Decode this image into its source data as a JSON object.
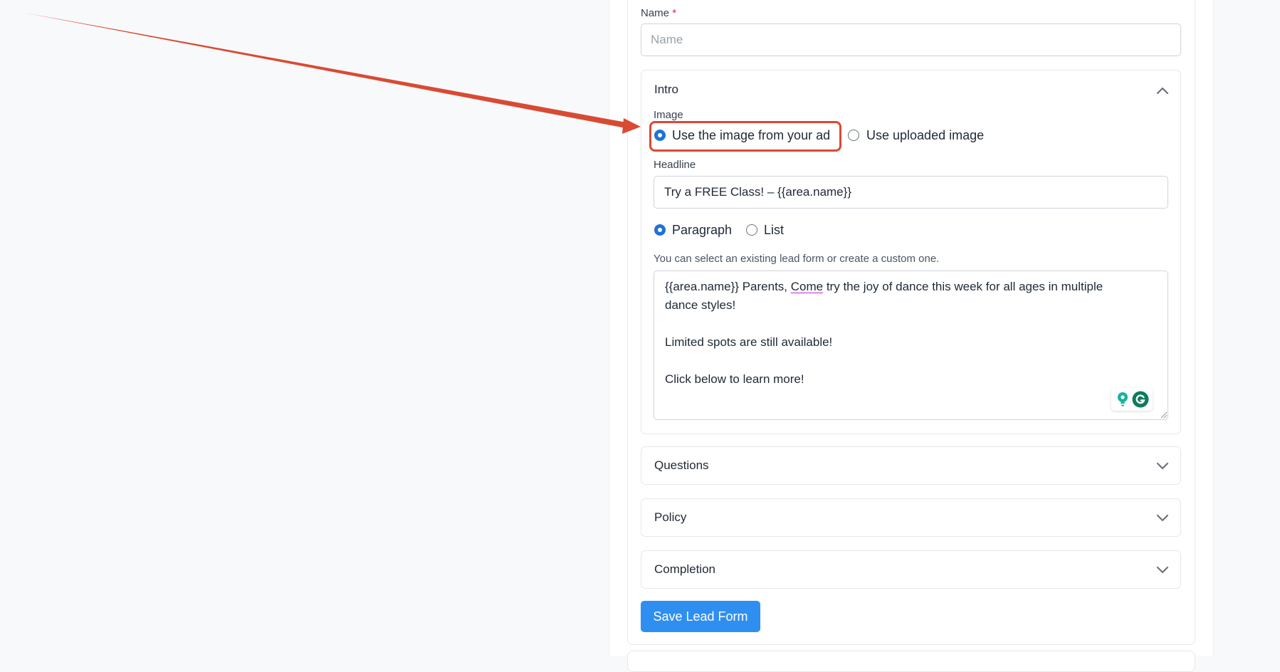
{
  "colors": {
    "accent": "#2f8ff0",
    "radio_checked": "#1e72d9",
    "annotation": "#d94a33",
    "required": "#e11d48"
  },
  "name_field": {
    "label": "Name",
    "required_mark": "*",
    "placeholder": "Name",
    "value": ""
  },
  "intro": {
    "title": "Intro",
    "expanded": true,
    "image_label": "Image",
    "image_options": [
      {
        "label": "Use the image from your ad",
        "selected": true
      },
      {
        "label": "Use uploaded image",
        "selected": false
      }
    ],
    "headline_label": "Headline",
    "headline_value": "Try a FREE Class! – {{area.name}}",
    "format_options": [
      {
        "label": "Paragraph",
        "selected": true
      },
      {
        "label": "List",
        "selected": false
      }
    ],
    "hint": "You can select an existing lead form or create a custom one.",
    "body_lines": {
      "line1_pre": "{{area.name}} Parents, ",
      "line1_come": "Come",
      "line1_post": " try the joy of dance this week for all ages in multiple",
      "line2": "dance styles!",
      "line3": "Limited spots are still available!",
      "line4": "Click below to learn more!"
    }
  },
  "sections": [
    {
      "title": "Questions",
      "expanded": false
    },
    {
      "title": "Policy",
      "expanded": false
    },
    {
      "title": "Completion",
      "expanded": false
    }
  ],
  "save_button": {
    "label": "Save Lead Form"
  },
  "icons": {
    "chevron_up": "chevron-up-icon",
    "chevron_down": "chevron-down-icon",
    "grammarly": "grammarly-icon",
    "suggestion": "lightbulb-icon"
  }
}
